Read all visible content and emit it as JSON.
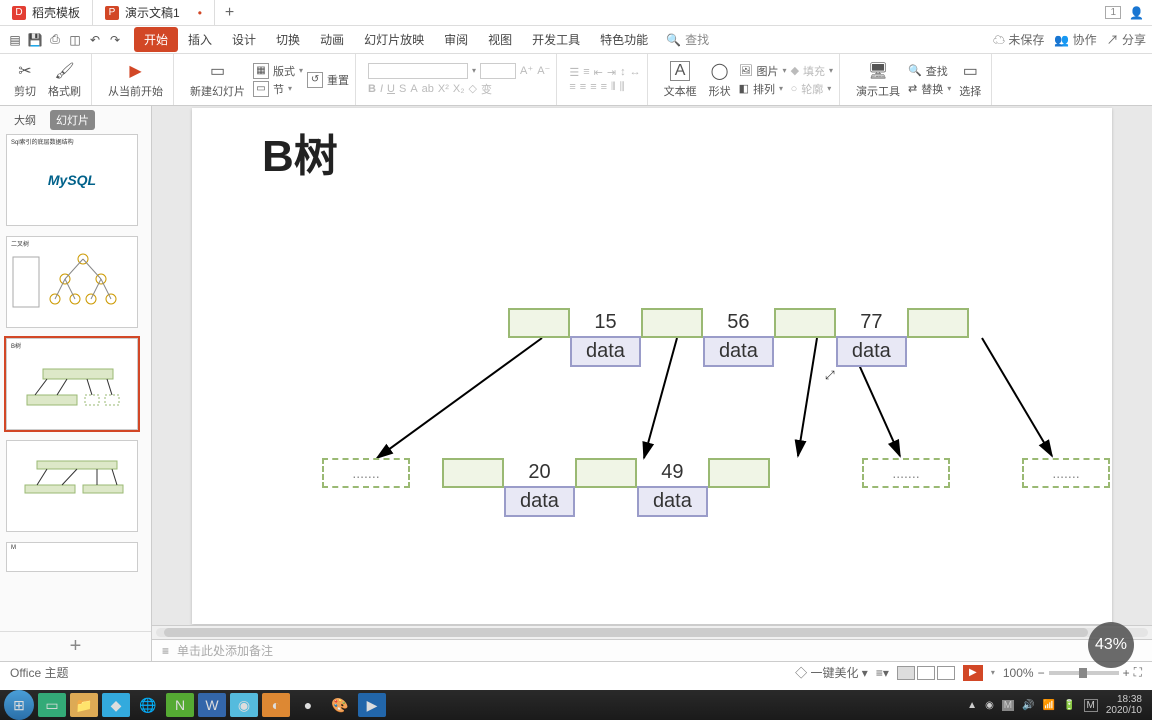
{
  "tabs": {
    "template": "稻壳模板",
    "doc": "演示文稿1",
    "add": "+"
  },
  "titleRight": {
    "badge": "1"
  },
  "menu": {
    "items": [
      "开始",
      "插入",
      "设计",
      "切换",
      "动画",
      "幻灯片放映",
      "审阅",
      "视图",
      "开发工具",
      "特色功能"
    ],
    "search": "查找",
    "right": {
      "unsaved": "未保存",
      "collab": "协作",
      "share": "分享"
    }
  },
  "ribbon": {
    "cut": "剪切",
    "brush": "格式刷",
    "play": "从当前开始",
    "newslide": "新建幻灯片",
    "layout": "版式",
    "section": "节",
    "reset": "重置",
    "textbox": "文本框",
    "shape": "形状",
    "arrange": "排列",
    "image": "图片",
    "fill": "填充",
    "outline": "轮廓",
    "tools": "演示工具",
    "find": "查找",
    "replace": "替换",
    "select": "选择"
  },
  "panel": {
    "outline": "大纲",
    "slides": "幻灯片"
  },
  "slide": {
    "title": "B树",
    "root": [
      {
        "key": "15",
        "data": "data"
      },
      {
        "key": "56",
        "data": "data"
      },
      {
        "key": "77",
        "data": "data"
      }
    ],
    "child": [
      {
        "key": "20",
        "data": "data"
      },
      {
        "key": "49",
        "data": "data"
      }
    ],
    "dots": "......."
  },
  "notes": {
    "placeholder": "单击此处添加备注"
  },
  "theme": "Office 主题",
  "status": {
    "beautify": "一键美化",
    "zoom": "100%"
  },
  "floatBadge": "43%",
  "taskbar": {
    "time": "18:38",
    "date": "2020/10"
  }
}
